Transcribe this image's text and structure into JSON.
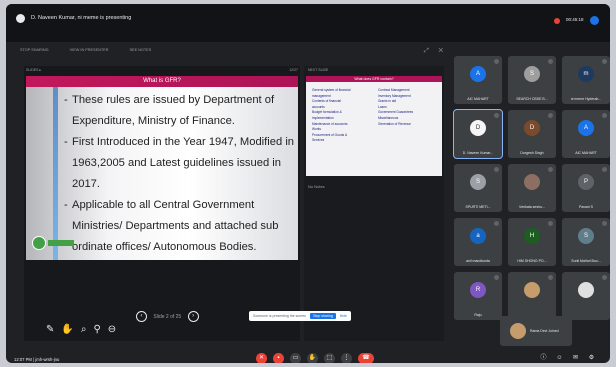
{
  "banner": {
    "presenting": "D. Naveen Kumar, ni meme is presenting",
    "rec_time": "00:45:18"
  },
  "toolbar": {
    "item1": "STOP SHARING",
    "item2": "VIEW IN PRESENTER",
    "item3": "SEE NOTES"
  },
  "slide_pane": {
    "left_meta": "SLIDES  ▸",
    "right_meta": "12/27",
    "title": "What is GFR?",
    "bullets": [
      "These rules are issued by Department of",
      "Expenditure, Ministry of Finance.",
      "First Introduced in the Year 1947, Modified in",
      "1963,2005 and Latest guidelines issued in",
      "2017.",
      "Applicable to all Central Government",
      "Ministries/ Departments and attached sub",
      "ordinate offices/ Autonomous Bodies."
    ]
  },
  "notes_pane": {
    "head": "NEXT SLIDE",
    "mini_title": "What does GFR contain?",
    "left_col": [
      "General system of financial",
      "management",
      "Contents of financial",
      "accounts",
      "Budget formulation &",
      "implementation",
      "Maintenance of accounts",
      "Works",
      "Procurement of Goods &",
      "Services"
    ],
    "right_col": [
      "Contract Management",
      "Inventory Management",
      "Grants in aid",
      "Loans",
      "Government Guarantees",
      "Miscellaneous",
      "Generation of Revenue"
    ],
    "no_notes": "No Notes"
  },
  "pager": {
    "label": "Slide 2 of 25"
  },
  "share_notice": {
    "text": "Someone is presenting the screen",
    "stop": "Stop sharing",
    "hide": "Hide"
  },
  "tiles": [
    {
      "initial": "A",
      "name": "AIC MAHART",
      "color": "#1a73e8"
    },
    {
      "initial": "S",
      "name": "SEARCH CBSE B...",
      "color": "#9e9e9e"
    },
    {
      "initial": "m",
      "name": "ni meme Hyderab...",
      "color": "#1e3a5f"
    },
    {
      "initial": "D",
      "name": "D. Naveen Kumar...",
      "color": "#f5f5f5"
    },
    {
      "initial": "D",
      "name": "Durgesh Singh",
      "color": "#7b4a2a"
    },
    {
      "initial": "A",
      "name": "AIC MAHART",
      "color": "#1a73e8"
    },
    {
      "initial": "S",
      "name": "SPURTI METI...",
      "color": "#9aa0a6"
    },
    {
      "initial": "",
      "name": "Venkata seshu...",
      "color": "#8d6e63"
    },
    {
      "initial": "P",
      "name": "Pavani S",
      "color": "#5f6368"
    },
    {
      "initial": "a",
      "name": "anil mandlunda",
      "color": "#1565c0"
    },
    {
      "initial": "H",
      "name": "HIM SHONG PO...",
      "color": "#1b5e20"
    },
    {
      "initial": "S",
      "name": "Sunil Malhot Bou...",
      "color": "#607d8b"
    },
    {
      "initial": "R",
      "name": "Raju",
      "color": "#7e57c2"
    },
    {
      "initial": "",
      "name": "",
      "color": "#c69c6d"
    },
    {
      "initial": "",
      "name": "",
      "color": "#e0e0e0"
    }
  ],
  "self_view": {
    "name": "Rama Devi Joined"
  },
  "clock": {
    "text": "12:07 PM  |  jmh-wrsh-jnu"
  }
}
